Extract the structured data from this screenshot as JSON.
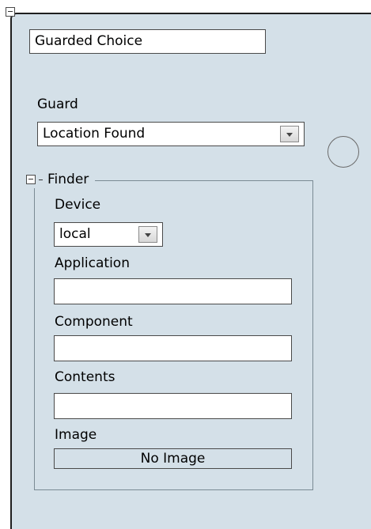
{
  "choice": {
    "name_value": "Guarded Choice"
  },
  "guard": {
    "label": "Guard",
    "selected": "Location Found"
  },
  "finder": {
    "title": "Finder",
    "device_label": "Device",
    "device_selected": "local",
    "application_label": "Application",
    "application_value": "",
    "component_label": "Component",
    "component_value": "",
    "contents_label": "Contents",
    "contents_value": "",
    "image_label": "Image",
    "image_value": "No Image"
  },
  "colors": {
    "panel_background": "#d4e0e8",
    "border": "#1f1f1f"
  },
  "icons": {
    "collapse": "minus-box-icon",
    "dropdown": "chevron-down-icon",
    "connector": "circle-node-icon"
  }
}
